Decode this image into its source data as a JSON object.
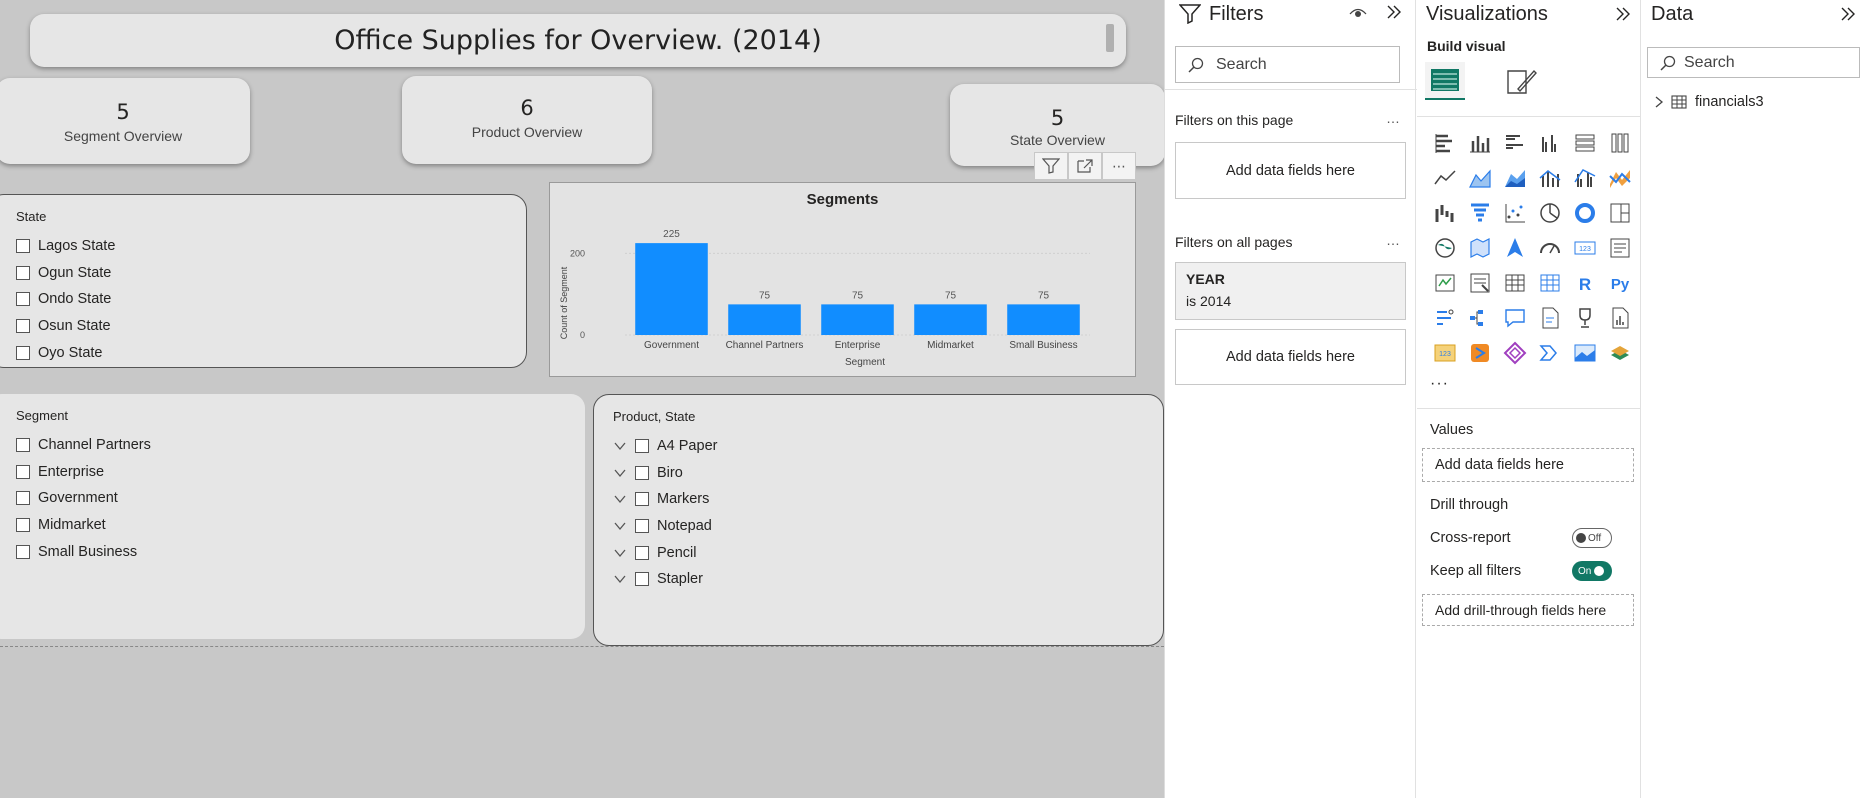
{
  "canvas": {
    "title": "Office Supplies for Overview. (2014)",
    "kpis": [
      {
        "value": "5",
        "label": "Segment Overview"
      },
      {
        "value": "6",
        "label": "Product Overview"
      },
      {
        "value": "5",
        "label": "State Overview"
      }
    ],
    "state_slicer": {
      "header": "State",
      "items": [
        "Lagos State",
        "Ogun State",
        "Ondo State",
        "Osun State",
        "Oyo State"
      ]
    },
    "segment_slicer": {
      "header": "Segment",
      "items": [
        "Channel Partners",
        "Enterprise",
        "Government",
        "Midmarket",
        "Small Business"
      ]
    },
    "product_slicer": {
      "header": "Product, State",
      "items": [
        "A4 Paper",
        "Biro",
        "Markers",
        "Notepad",
        "Pencil",
        "Stapler"
      ]
    },
    "chart_toolbar": {
      "more": "⋯"
    }
  },
  "chart_data": {
    "type": "bar",
    "title": "Segments",
    "xlabel": "Segment",
    "ylabel": "Count of Segment",
    "categories": [
      "Government",
      "Channel Partners",
      "Enterprise",
      "Midmarket",
      "Small Business"
    ],
    "values": [
      225,
      75,
      75,
      75,
      75
    ],
    "data_labels": [
      "225",
      "75",
      "75",
      "75",
      "75"
    ],
    "yticks": [
      0,
      200
    ],
    "ytick_labels": [
      "0",
      "200"
    ],
    "ylim": [
      0,
      240
    ],
    "bar_color": "#118DFF",
    "grid": true,
    "legend": "none"
  },
  "filters": {
    "title": "Filters",
    "search_placeholder": "Search",
    "on_this_page": "Filters on this page",
    "on_all_pages": "Filters on all pages",
    "add_fields": "Add data fields here",
    "add_fields_2": "Add data fields here",
    "year_filter": {
      "field": "YEAR",
      "condition": "is 2014"
    },
    "dots": "…",
    "dots_2": "…"
  },
  "visualizations": {
    "title": "Visualizations",
    "build_visual": "Build visual",
    "more": "···",
    "values_label": "Values",
    "values_well": "Add data fields here",
    "drill_through": "Drill through",
    "cross_report": "Cross-report",
    "cross_report_state": "Off",
    "keep_all_filters": "Keep all filters",
    "keep_all_filters_state": "On",
    "drill_well": "Add drill-through fields here",
    "r_label": "R",
    "py_label": "Py",
    "num_label": "123"
  },
  "data": {
    "title": "Data",
    "search_placeholder": "Search",
    "tables": [
      "financials3"
    ]
  },
  "colors": {
    "accent": "#117865",
    "bar": "#118DFF",
    "canvas_bg": "#c8c8c8",
    "card_bg": "#e6e6e6"
  }
}
